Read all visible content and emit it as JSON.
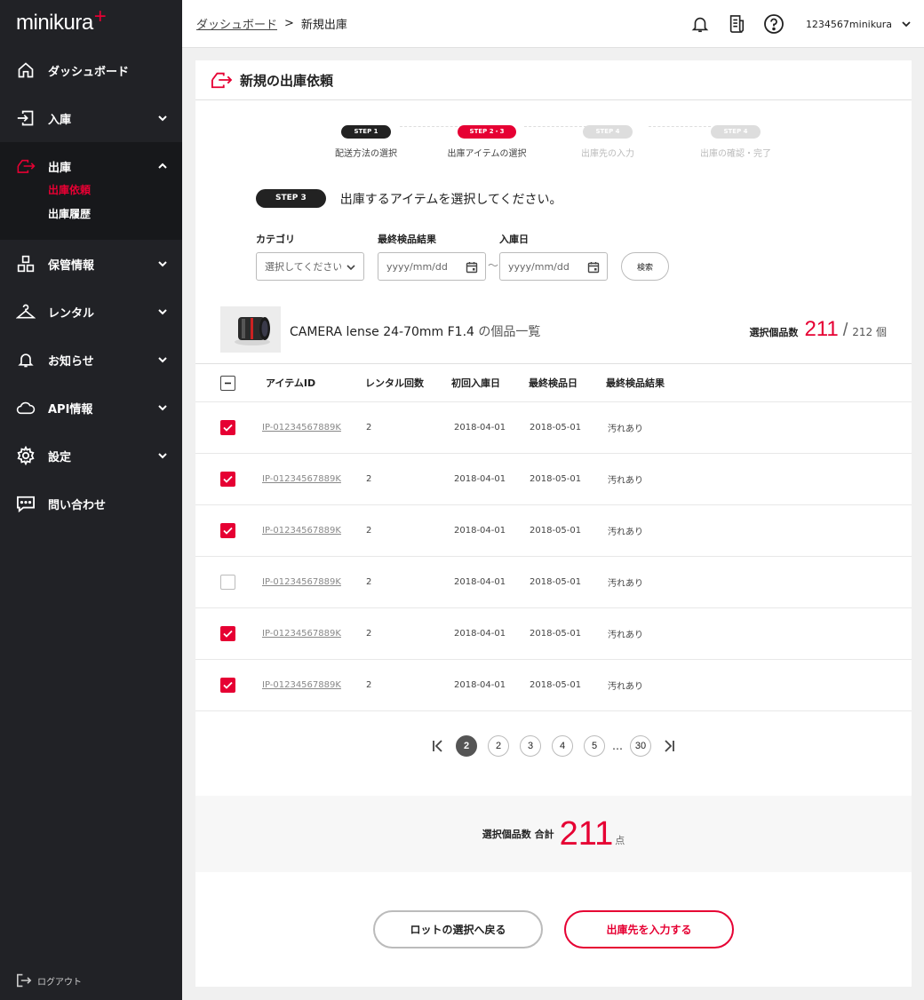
{
  "brand": {
    "name": "minikura",
    "plus": "+",
    "accent": "#e60033"
  },
  "sidebar": {
    "items": [
      {
        "label": "ダッシュボード"
      },
      {
        "label": "入庫"
      },
      {
        "label": "出庫",
        "sub": [
          {
            "label": "出庫依頼"
          },
          {
            "label": "出庫履歴"
          }
        ]
      },
      {
        "label": "保管情報"
      },
      {
        "label": "レンタル"
      },
      {
        "label": "お知らせ"
      },
      {
        "label": "API情報"
      },
      {
        "label": "設定"
      },
      {
        "label": "問い合わせ"
      }
    ],
    "logout": "ログアウト"
  },
  "header": {
    "breadcrumb": {
      "parent": "ダッシュボード",
      "separator": ">",
      "current": "新規出庫"
    },
    "user": "1234567minikura"
  },
  "page": {
    "title": "新規の出庫依頼"
  },
  "steps": [
    {
      "badge": "STEP 1",
      "label": "配送方法の選択",
      "color": "#222222"
    },
    {
      "badge": "STEP 2・3",
      "label": "出庫アイテムの選択",
      "color": "#e60033"
    },
    {
      "badge": "STEP 4",
      "label": "出庫先の入力",
      "color": "#dddddd"
    },
    {
      "badge": "STEP 4",
      "label": "出庫の確認・完了",
      "color": "#dddddd"
    }
  ],
  "instruction": {
    "badge": "STEP 3",
    "text": "出庫するアイテムを選択してください。"
  },
  "filters": {
    "category_label": "カテゴリ",
    "category_value": "選択してください",
    "last_result_label": "最終検品結果",
    "last_result_placeholder": "yyyy/mm/dd",
    "date_label": "入庫日",
    "date_placeholder": "yyyy/mm/dd",
    "tilde": "〜",
    "search": "検索"
  },
  "product": {
    "name": "CAMERA lense 24-70mm F1.4",
    "suffix": "の個品一覧",
    "count_label": "選択個品数",
    "selected": "211",
    "slash": "/",
    "total": "212 個"
  },
  "table": {
    "headers": [
      "アイテムID",
      "レンタル回数",
      "初回入庫日",
      "最終検品日",
      "最終検品結果"
    ],
    "rows": [
      {
        "checked": true,
        "id": "IP-01234567889K",
        "rentals": "2",
        "first": "2018-04-01",
        "last": "2018-05-01",
        "result": "汚れあり"
      },
      {
        "checked": true,
        "id": "IP-01234567889K",
        "rentals": "2",
        "first": "2018-04-01",
        "last": "2018-05-01",
        "result": "汚れあり"
      },
      {
        "checked": true,
        "id": "IP-01234567889K",
        "rentals": "2",
        "first": "2018-04-01",
        "last": "2018-05-01",
        "result": "汚れあり"
      },
      {
        "checked": false,
        "id": "IP-01234567889K",
        "rentals": "2",
        "first": "2018-04-01",
        "last": "2018-05-01",
        "result": "汚れあり"
      },
      {
        "checked": true,
        "id": "IP-01234567889K",
        "rentals": "2",
        "first": "2018-04-01",
        "last": "2018-05-01",
        "result": "汚れあり"
      },
      {
        "checked": true,
        "id": "IP-01234567889K",
        "rentals": "2",
        "first": "2018-04-01",
        "last": "2018-05-01",
        "result": "汚れあり"
      }
    ]
  },
  "pagination": {
    "current": "2",
    "pages": [
      "2",
      "3",
      "4",
      "5"
    ],
    "ellipsis": "…",
    "last": "30"
  },
  "summary": {
    "label": "選択個品数 合計",
    "value": "211",
    "unit": "点"
  },
  "actions": {
    "back": "ロットの選択へ戻る",
    "next": "出庫先を入力する"
  }
}
